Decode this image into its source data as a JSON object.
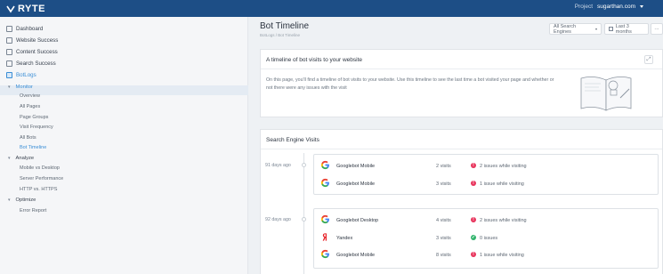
{
  "header": {
    "logo_text": "RYTE",
    "project_label": "Project",
    "project_value": "sugarthan.com"
  },
  "sidebar": {
    "items": [
      {
        "label": "Dashboard",
        "icon": "dashboard-icon"
      },
      {
        "label": "Website Success",
        "icon": "website-icon"
      },
      {
        "label": "Content Success",
        "icon": "content-icon"
      },
      {
        "label": "Search Success",
        "icon": "search-icon"
      },
      {
        "label": "BotLogs",
        "icon": "botlogs-icon",
        "active": true
      }
    ],
    "groups": [
      {
        "label": "Monitor",
        "active": true,
        "subs": [
          "Overview",
          "All Pages",
          "Page Groups",
          "Visit Frequency",
          "All Bots",
          "Bot Timeline"
        ],
        "active_sub": "Bot Timeline"
      },
      {
        "label": "Analyze",
        "subs": [
          "Mobile vs Desktop",
          "Server Performance",
          "HTTP vs. HTTPS"
        ]
      },
      {
        "label": "Optimize",
        "subs": [
          "Error Report"
        ]
      }
    ]
  },
  "page": {
    "title": "Bot Timeline",
    "breadcrumb": "BotLogs  /  Bot Timeline",
    "filter_engines": "All Search Engines",
    "filter_period": "Last 3 months",
    "more": "···"
  },
  "intro": {
    "title": "A timeline of bot visits to your website",
    "text": "On this page, you'll find a timeline of bot visits to your website. Use this timeline to see the last time a bot visited your page and whether or not there were any issues with the visit"
  },
  "visits": {
    "title": "Search Engine Visits",
    "groups": [
      {
        "date": "91 days ago",
        "rows": [
          {
            "engine": "google",
            "bot": "Googlebot Mobile",
            "visits": "2 visits",
            "status": "warn",
            "status_text": "2 issues while visiting"
          },
          {
            "engine": "google",
            "bot": "Googlebot Mobile",
            "visits": "3 visits",
            "status": "warn",
            "status_text": "1 issue while visiting"
          }
        ]
      },
      {
        "date": "92 days ago",
        "rows": [
          {
            "engine": "google",
            "bot": "Googlebot Desktop",
            "visits": "4 visits",
            "status": "warn",
            "status_text": "2 issues while visiting"
          },
          {
            "engine": "yandex",
            "bot": "Yandex",
            "visits": "3 visits",
            "status": "ok",
            "status_text": "0 issues"
          },
          {
            "engine": "google",
            "bot": "Googlebot Mobile",
            "visits": "8 visits",
            "status": "warn",
            "status_text": "1 issue while visiting"
          }
        ]
      }
    ]
  },
  "colors": {
    "topbar": "#1d4e86",
    "accent": "#3a8ed6",
    "warn": "#e8345c",
    "ok": "#2fb36b"
  }
}
